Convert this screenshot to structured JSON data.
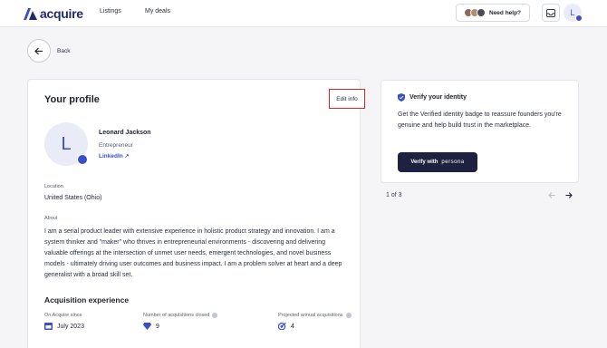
{
  "nav": {
    "logo_text": "acquire",
    "links": [
      "Listings",
      "My deals"
    ],
    "help_label": "Need help?",
    "user_initial": "L"
  },
  "back_label": "Back",
  "profile": {
    "title": "Your profile",
    "edit_label": "Edit info",
    "avatar_initial": "L",
    "name": "Leonard Jackson",
    "role": "Entrepreneur",
    "linkedin_label": "LinkedIn",
    "location_label": "Location",
    "location_value": "United States (Ohio)",
    "about_label": "About",
    "about_text": "I am a serial product leader with extensive experience in holistic product strategy and innovation. I am a system thinker and \"maker\" who thrives in entrepreneurial environments - discovering and delivering valuable offerings at the intersection of unmet user needs, emergent technologies, and novel business models - ultimately driving user outcomes and business impact. I am a problem solver at heart and a deep generalist with a broad skill set."
  },
  "acquisition": {
    "title": "Acquisition experience",
    "stats": [
      {
        "label": "On Acquire since",
        "value": "July 2023",
        "icon": "calendar-icon"
      },
      {
        "label": "Number of acquisitions closed",
        "value": "9",
        "icon": "diamond-icon"
      },
      {
        "label": "Projected annual acquisitions",
        "value": "4",
        "icon": "target-icon"
      }
    ]
  },
  "verify": {
    "title": "Verify your identity",
    "text": "Get the Verified identity badge to reassure founders you're genuine and help build trust in the marketplace.",
    "button_label": "Verify with",
    "button_brand": "persona"
  },
  "pager": {
    "text": "1 of 3"
  },
  "colors": {
    "brand": "#3b4ec7",
    "dark": "#1f2140",
    "highlight": "#d9262b"
  }
}
